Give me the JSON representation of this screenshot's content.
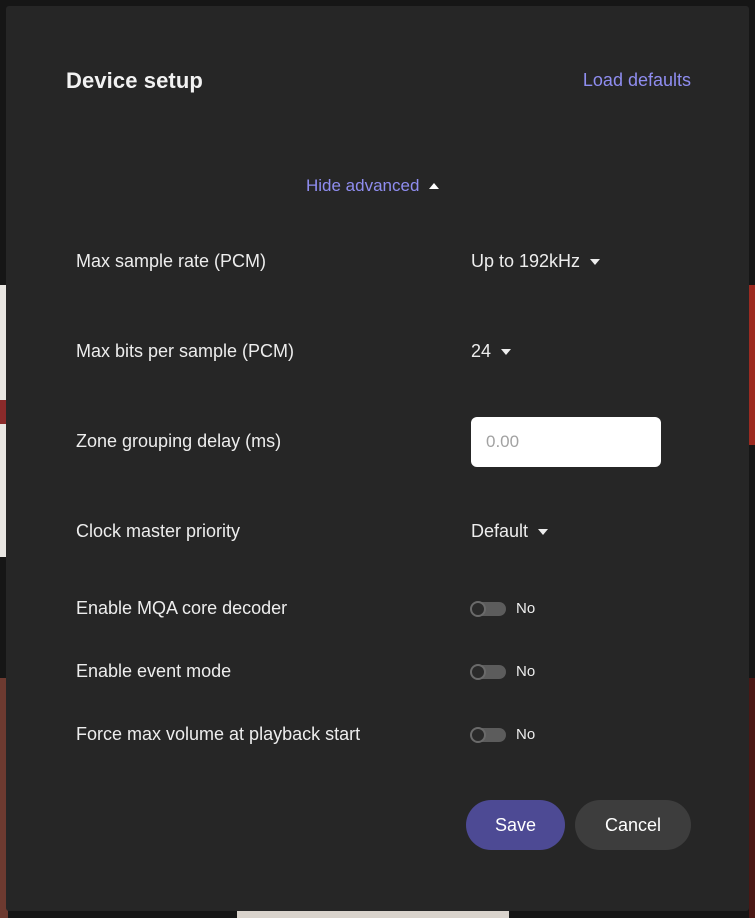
{
  "dialog": {
    "title": "Device setup",
    "load_defaults_label": "Load defaults",
    "hide_advanced_label": "Hide advanced"
  },
  "settings": {
    "max_sample_rate": {
      "label": "Max sample rate (PCM)",
      "value": "Up to 192kHz"
    },
    "max_bits": {
      "label": "Max bits per sample (PCM)",
      "value": "24"
    },
    "zone_delay": {
      "label": "Zone grouping delay (ms)",
      "placeholder": "0.00"
    },
    "clock_master": {
      "label": "Clock master priority",
      "value": "Default"
    },
    "mqa_decoder": {
      "label": "Enable MQA core decoder",
      "value": "No"
    },
    "event_mode": {
      "label": "Enable event mode",
      "value": "No"
    },
    "force_max_volume": {
      "label": "Force max volume at playback start",
      "value": "No"
    }
  },
  "buttons": {
    "save_label": "Save",
    "cancel_label": "Cancel"
  },
  "icons": {
    "hide_advanced": "caret-up-icon",
    "select": "caret-down-icon"
  },
  "colors": {
    "accent_link": "#8f8df0",
    "save_button": "#4d4a94",
    "cancel_button": "#3d3d3d",
    "modal_bg": "#262626"
  }
}
